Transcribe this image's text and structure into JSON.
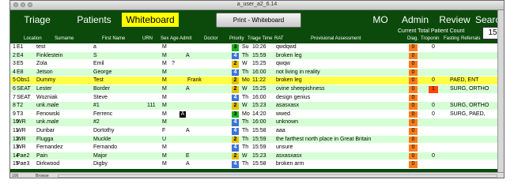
{
  "window": {
    "title": "a_user_a2_6.14"
  },
  "nav": {
    "triage": "Triage",
    "patients": "Patients",
    "whiteboard": "Whiteboard",
    "print": "Print - Whiteboard",
    "mo": "MO",
    "admin": "Admin",
    "review": "Review",
    "search": "Search"
  },
  "count": {
    "label": "Current Total Patient Count",
    "value": "15"
  },
  "columns": {
    "location": "Location",
    "surname": "Surname",
    "first_name": "First Name",
    "urn": "URN",
    "sex": "Sex",
    "age": "Age",
    "admit": "Admit",
    "doctor": "Doctor",
    "priority": "Priority",
    "triage_time": "Triage Time",
    "rat": "RAT",
    "assessment": "Provisional Assessment",
    "diag": "Diag.",
    "troponin": "Troponin",
    "fasting": "Fasting",
    "referrals": "Referrals"
  },
  "rows": [
    {
      "num": "1",
      "loc": "E1",
      "surname": "test",
      "first": "a",
      "urn": "",
      "sex": "M",
      "age": "",
      "admit": "",
      "doctor": "",
      "prio": "3",
      "day": "Su",
      "time": "10:26",
      "assess": "qwdqwd",
      "diag": "0",
      "trop": "0",
      "ref": ""
    },
    {
      "num": "2",
      "loc": "E4",
      "surname": "Finklestein",
      "first": "S",
      "urn": "",
      "sex": "M",
      "age": "",
      "admit": "A",
      "doctor": "",
      "prio": "4",
      "day": "Th",
      "time": "15:59",
      "assess": "broken leg",
      "diag": "0",
      "trop": "",
      "ref": ""
    },
    {
      "num": "3",
      "loc": "E5",
      "surname": "Zola",
      "first": "Emil",
      "urn": "",
      "sex": "M",
      "age": "?",
      "admit": "",
      "doctor": "",
      "prio": "2",
      "day": "W",
      "time": "15:25",
      "assess": "qwqw",
      "diag": "0",
      "trop": "",
      "ref": ""
    },
    {
      "num": "4",
      "loc": "E8",
      "surname": "Jetson",
      "first": "George",
      "urn": "",
      "sex": "M",
      "age": "",
      "admit": "",
      "doctor": "",
      "prio": "4",
      "day": "Th",
      "time": "16:00",
      "assess": "not living in reality",
      "diag": "0",
      "trop": "",
      "ref": ""
    },
    {
      "num": "5",
      "loc": "Obs1",
      "surname": "Dummy",
      "first": "Test",
      "urn": "",
      "sex": "M",
      "age": "",
      "admit": "",
      "doctor": "Frank",
      "prio": "2",
      "day": "Mo",
      "time": "11:22",
      "assess": "broken leg",
      "diag": "0",
      "trop": "0",
      "ref": "PAED, ENT"
    },
    {
      "num": "6",
      "loc": "SEAT",
      "surname": "Lester",
      "first": "Border",
      "urn": "",
      "sex": "M",
      "age": "",
      "admit": "A",
      "doctor": "",
      "prio": "2",
      "day": "W",
      "time": "15:25",
      "assess": "ovine sheepishness",
      "diag": "0",
      "trop": "1",
      "ref": "SURG, ORTHO"
    },
    {
      "num": "7",
      "loc": "SEAT",
      "surname": "Wozniak",
      "first": "Steve",
      "urn": "",
      "sex": "M",
      "age": "",
      "admit": "",
      "doctor": "",
      "prio": "4",
      "day": "Th",
      "time": "16:00",
      "assess": "design genius",
      "diag": "0",
      "trop": "",
      "ref": ""
    },
    {
      "num": "8",
      "loc": "T2",
      "surname": "unk.male",
      "first": "#1",
      "urn": "111",
      "sex": "M",
      "age": "",
      "admit": "",
      "doctor": "",
      "prio": "2",
      "day": "W",
      "time": "15:23",
      "assess": "asasxasx",
      "diag": "0",
      "trop": "0",
      "ref": "SURG, ORTHO"
    },
    {
      "num": "9",
      "loc": "T3",
      "surname": "Fenowski",
      "first": "Ferrenc",
      "urn": "",
      "sex": "M",
      "age": "",
      "admit": "A",
      "doctor": "",
      "prio": "3",
      "day": "Mo",
      "time": "14:20",
      "assess": "wwed",
      "diag": "0",
      "trop": "0",
      "ref": "SURG, PAED,"
    },
    {
      "num": "10",
      "loc": "WR",
      "surname": "unk.male",
      "first": "#2",
      "urn": "",
      "sex": "M",
      "age": "",
      "admit": "",
      "doctor": "",
      "prio": "4",
      "day": "Th",
      "time": "16:00",
      "assess": "unknown",
      "diag": "0",
      "trop": "",
      "ref": ""
    },
    {
      "num": "11",
      "loc": "WR",
      "surname": "Dunbar",
      "first": "Dortothy",
      "urn": "",
      "sex": "F",
      "age": "",
      "admit": "A",
      "doctor": "",
      "prio": "4",
      "day": "Th",
      "time": "15:58",
      "assess": "aaa",
      "diag": "0",
      "trop": "",
      "ref": ""
    },
    {
      "num": "12",
      "loc": "WR",
      "surname": "Flugga",
      "first": "Muckle",
      "urn": "",
      "sex": "U",
      "age": "",
      "admit": "",
      "doctor": "",
      "prio": "2",
      "day": "Th",
      "time": "15:59",
      "assess": "the farthest north place in Great Britain",
      "diag": "0",
      "trop": "",
      "ref": ""
    },
    {
      "num": "13",
      "loc": "WR",
      "surname": "Fernandez",
      "first": "Fernando",
      "urn": "",
      "sex": "M",
      "age": "",
      "admit": "",
      "doctor": "",
      "prio": "4",
      "day": "Th",
      "time": "15:59",
      "assess": "unsure",
      "diag": "0",
      "trop": "",
      "ref": ""
    },
    {
      "num": "14",
      "loc": "Pae2",
      "surname": "Pain",
      "first": "Major",
      "urn": "",
      "sex": "M",
      "age": "",
      "admit": "E",
      "doctor": "",
      "prio": "2",
      "day": "W",
      "time": "15:23",
      "assess": "asxasxasx",
      "diag": "0",
      "trop": "0",
      "ref": ""
    },
    {
      "num": "15",
      "loc": "Pae3",
      "surname": "Dirkwood",
      "first": "Digby",
      "urn": "",
      "sex": "M",
      "age": "",
      "admit": "A",
      "doctor": "",
      "prio": "4",
      "day": "Th",
      "time": "15:58",
      "assess": "broken arm",
      "diag": "0",
      "trop": "",
      "ref": ""
    }
  ],
  "status": {
    "zoom": "100",
    "mode": "Browse"
  }
}
